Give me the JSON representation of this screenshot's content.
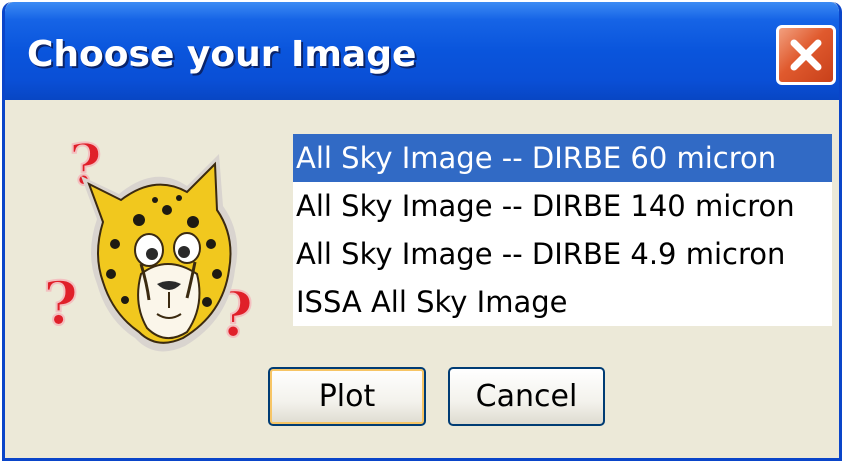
{
  "window": {
    "title": "Choose your Image"
  },
  "listbox": {
    "items": [
      "All Sky Image -- DIRBE 60 micron",
      "All Sky Image -- DIRBE 140 micron",
      "All Sky Image -- DIRBE 4.9 micron",
      "ISSA All Sky Image"
    ],
    "selected_index": 0
  },
  "buttons": {
    "plot_label": "Plot",
    "cancel_label": "Cancel"
  },
  "icons": {
    "close": "close-icon",
    "mascot": "cheetah-question-icon"
  },
  "colors": {
    "titlebar": "#0a55dc",
    "selection": "#316ac5",
    "dialog_bg": "#ece9d8",
    "close_button": "#e05a2e",
    "question_marks": "#e0202a"
  }
}
